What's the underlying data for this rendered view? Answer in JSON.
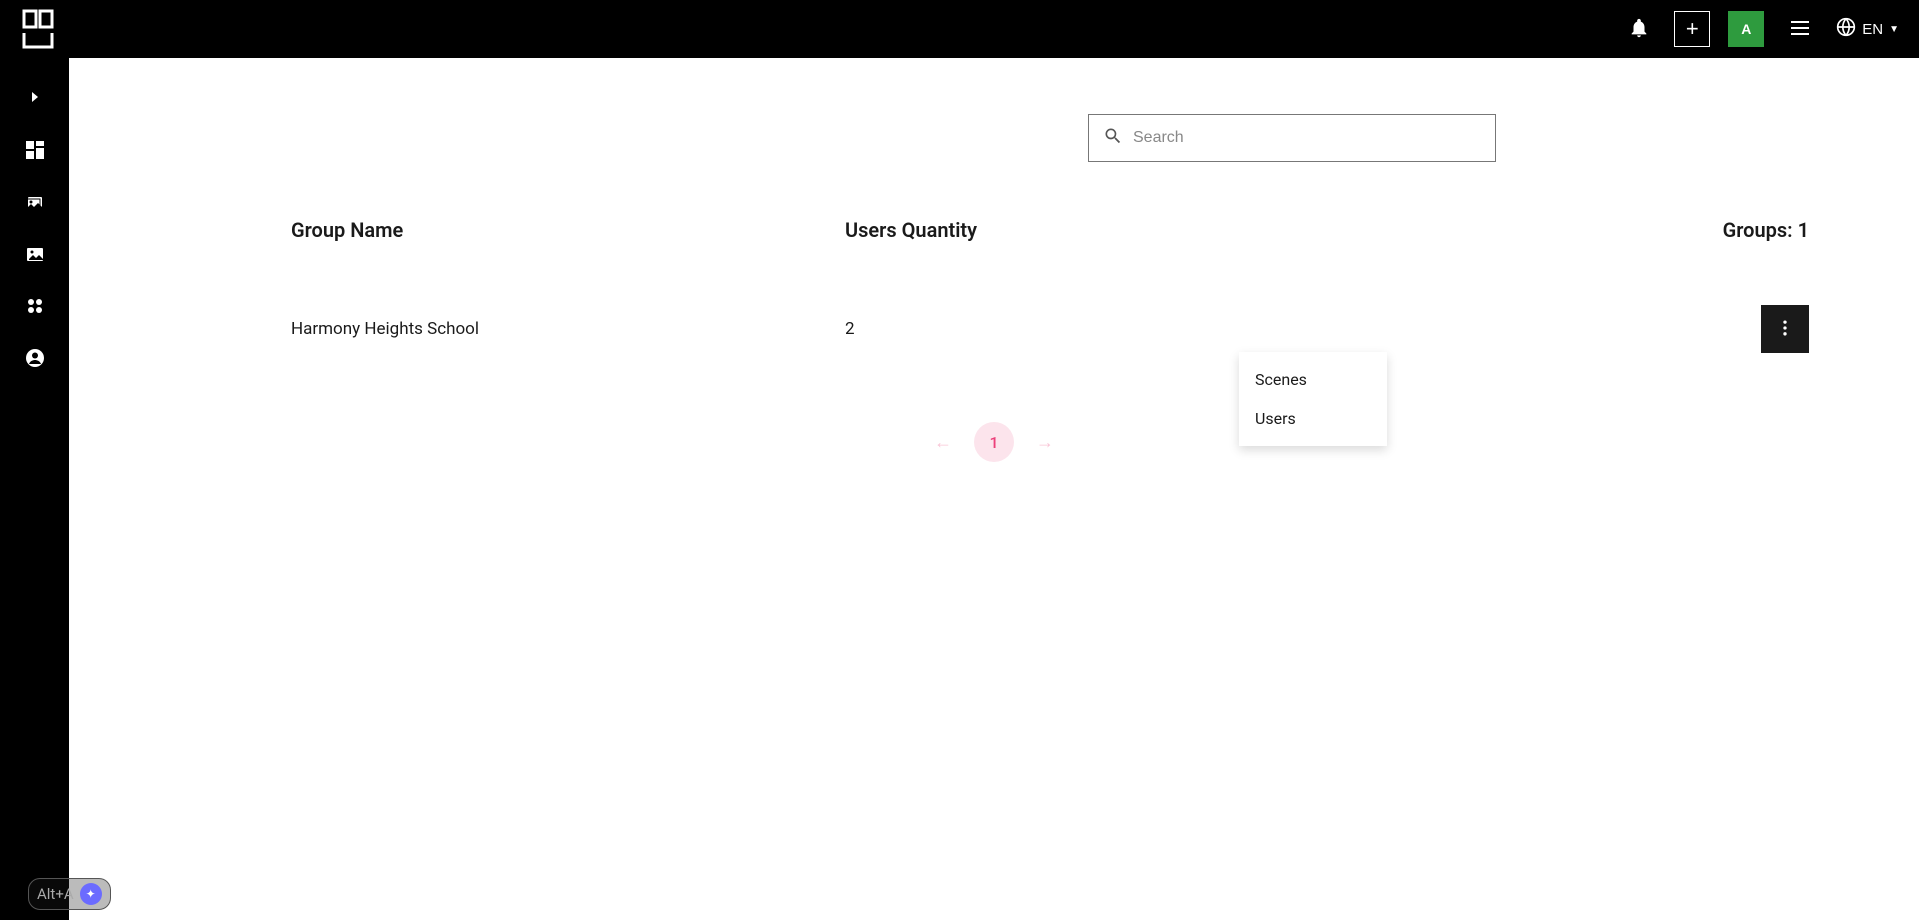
{
  "header": {
    "avatar_initial": "A",
    "lang_code": "EN"
  },
  "search": {
    "placeholder": "Search"
  },
  "table": {
    "headers": {
      "group_name": "Group Name",
      "users_quantity": "Users Quantity",
      "groups_count_label": "Groups: 1"
    },
    "rows": [
      {
        "name": "Harmony Heights School",
        "users": "2"
      }
    ]
  },
  "dropdown": {
    "items": [
      "Scenes",
      "Users"
    ]
  },
  "pagination": {
    "current": "1"
  },
  "shortcut": {
    "label": "Alt+A"
  }
}
